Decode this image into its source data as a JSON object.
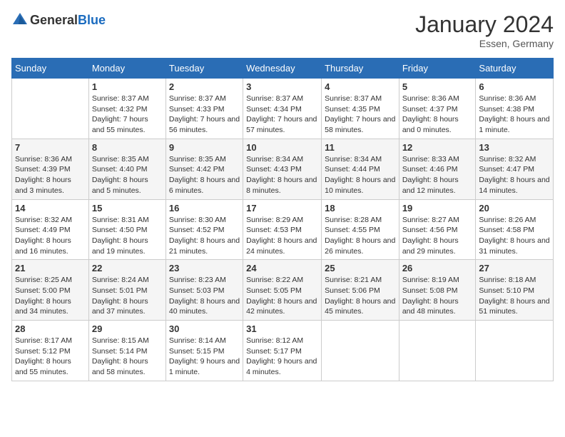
{
  "header": {
    "logo": {
      "general": "General",
      "blue": "Blue"
    },
    "title": "January 2024",
    "location": "Essen, Germany"
  },
  "calendar": {
    "days_of_week": [
      "Sunday",
      "Monday",
      "Tuesday",
      "Wednesday",
      "Thursday",
      "Friday",
      "Saturday"
    ],
    "weeks": [
      [
        {
          "day": null
        },
        {
          "day": 1,
          "sunrise": "Sunrise: 8:37 AM",
          "sunset": "Sunset: 4:32 PM",
          "daylight": "Daylight: 7 hours and 55 minutes."
        },
        {
          "day": 2,
          "sunrise": "Sunrise: 8:37 AM",
          "sunset": "Sunset: 4:33 PM",
          "daylight": "Daylight: 7 hours and 56 minutes."
        },
        {
          "day": 3,
          "sunrise": "Sunrise: 8:37 AM",
          "sunset": "Sunset: 4:34 PM",
          "daylight": "Daylight: 7 hours and 57 minutes."
        },
        {
          "day": 4,
          "sunrise": "Sunrise: 8:37 AM",
          "sunset": "Sunset: 4:35 PM",
          "daylight": "Daylight: 7 hours and 58 minutes."
        },
        {
          "day": 5,
          "sunrise": "Sunrise: 8:36 AM",
          "sunset": "Sunset: 4:37 PM",
          "daylight": "Daylight: 8 hours and 0 minutes."
        },
        {
          "day": 6,
          "sunrise": "Sunrise: 8:36 AM",
          "sunset": "Sunset: 4:38 PM",
          "daylight": "Daylight: 8 hours and 1 minute."
        }
      ],
      [
        {
          "day": 7,
          "sunrise": "Sunrise: 8:36 AM",
          "sunset": "Sunset: 4:39 PM",
          "daylight": "Daylight: 8 hours and 3 minutes."
        },
        {
          "day": 8,
          "sunrise": "Sunrise: 8:35 AM",
          "sunset": "Sunset: 4:40 PM",
          "daylight": "Daylight: 8 hours and 5 minutes."
        },
        {
          "day": 9,
          "sunrise": "Sunrise: 8:35 AM",
          "sunset": "Sunset: 4:42 PM",
          "daylight": "Daylight: 8 hours and 6 minutes."
        },
        {
          "day": 10,
          "sunrise": "Sunrise: 8:34 AM",
          "sunset": "Sunset: 4:43 PM",
          "daylight": "Daylight: 8 hours and 8 minutes."
        },
        {
          "day": 11,
          "sunrise": "Sunrise: 8:34 AM",
          "sunset": "Sunset: 4:44 PM",
          "daylight": "Daylight: 8 hours and 10 minutes."
        },
        {
          "day": 12,
          "sunrise": "Sunrise: 8:33 AM",
          "sunset": "Sunset: 4:46 PM",
          "daylight": "Daylight: 8 hours and 12 minutes."
        },
        {
          "day": 13,
          "sunrise": "Sunrise: 8:32 AM",
          "sunset": "Sunset: 4:47 PM",
          "daylight": "Daylight: 8 hours and 14 minutes."
        }
      ],
      [
        {
          "day": 14,
          "sunrise": "Sunrise: 8:32 AM",
          "sunset": "Sunset: 4:49 PM",
          "daylight": "Daylight: 8 hours and 16 minutes."
        },
        {
          "day": 15,
          "sunrise": "Sunrise: 8:31 AM",
          "sunset": "Sunset: 4:50 PM",
          "daylight": "Daylight: 8 hours and 19 minutes."
        },
        {
          "day": 16,
          "sunrise": "Sunrise: 8:30 AM",
          "sunset": "Sunset: 4:52 PM",
          "daylight": "Daylight: 8 hours and 21 minutes."
        },
        {
          "day": 17,
          "sunrise": "Sunrise: 8:29 AM",
          "sunset": "Sunset: 4:53 PM",
          "daylight": "Daylight: 8 hours and 24 minutes."
        },
        {
          "day": 18,
          "sunrise": "Sunrise: 8:28 AM",
          "sunset": "Sunset: 4:55 PM",
          "daylight": "Daylight: 8 hours and 26 minutes."
        },
        {
          "day": 19,
          "sunrise": "Sunrise: 8:27 AM",
          "sunset": "Sunset: 4:56 PM",
          "daylight": "Daylight: 8 hours and 29 minutes."
        },
        {
          "day": 20,
          "sunrise": "Sunrise: 8:26 AM",
          "sunset": "Sunset: 4:58 PM",
          "daylight": "Daylight: 8 hours and 31 minutes."
        }
      ],
      [
        {
          "day": 21,
          "sunrise": "Sunrise: 8:25 AM",
          "sunset": "Sunset: 5:00 PM",
          "daylight": "Daylight: 8 hours and 34 minutes."
        },
        {
          "day": 22,
          "sunrise": "Sunrise: 8:24 AM",
          "sunset": "Sunset: 5:01 PM",
          "daylight": "Daylight: 8 hours and 37 minutes."
        },
        {
          "day": 23,
          "sunrise": "Sunrise: 8:23 AM",
          "sunset": "Sunset: 5:03 PM",
          "daylight": "Daylight: 8 hours and 40 minutes."
        },
        {
          "day": 24,
          "sunrise": "Sunrise: 8:22 AM",
          "sunset": "Sunset: 5:05 PM",
          "daylight": "Daylight: 8 hours and 42 minutes."
        },
        {
          "day": 25,
          "sunrise": "Sunrise: 8:21 AM",
          "sunset": "Sunset: 5:06 PM",
          "daylight": "Daylight: 8 hours and 45 minutes."
        },
        {
          "day": 26,
          "sunrise": "Sunrise: 8:19 AM",
          "sunset": "Sunset: 5:08 PM",
          "daylight": "Daylight: 8 hours and 48 minutes."
        },
        {
          "day": 27,
          "sunrise": "Sunrise: 8:18 AM",
          "sunset": "Sunset: 5:10 PM",
          "daylight": "Daylight: 8 hours and 51 minutes."
        }
      ],
      [
        {
          "day": 28,
          "sunrise": "Sunrise: 8:17 AM",
          "sunset": "Sunset: 5:12 PM",
          "daylight": "Daylight: 8 hours and 55 minutes."
        },
        {
          "day": 29,
          "sunrise": "Sunrise: 8:15 AM",
          "sunset": "Sunset: 5:14 PM",
          "daylight": "Daylight: 8 hours and 58 minutes."
        },
        {
          "day": 30,
          "sunrise": "Sunrise: 8:14 AM",
          "sunset": "Sunset: 5:15 PM",
          "daylight": "Daylight: 9 hours and 1 minute."
        },
        {
          "day": 31,
          "sunrise": "Sunrise: 8:12 AM",
          "sunset": "Sunset: 5:17 PM",
          "daylight": "Daylight: 9 hours and 4 minutes."
        },
        {
          "day": null
        },
        {
          "day": null
        },
        {
          "day": null
        }
      ]
    ]
  }
}
